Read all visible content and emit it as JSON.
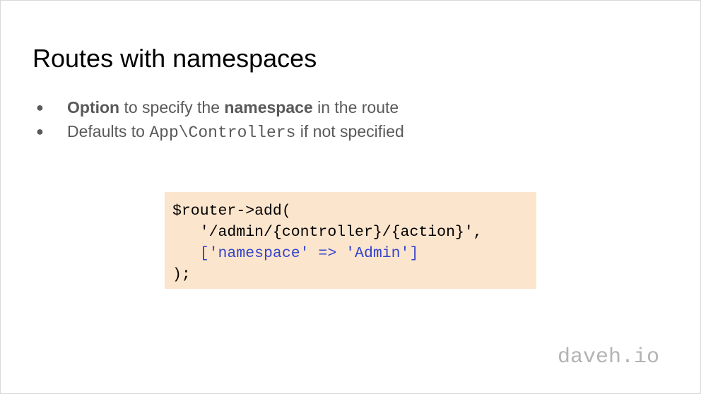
{
  "slide": {
    "title": "Routes with namespaces",
    "bullets": [
      {
        "marker": "●",
        "parts": [
          "Option",
          " to specify the ",
          "namespace",
          " in the route"
        ]
      },
      {
        "marker": "●",
        "parts": [
          "Defaults to ",
          "App\\Controllers",
          " if not specified"
        ]
      }
    ],
    "code": {
      "background_color": "#fce5cd",
      "line1": "$router->add(",
      "line2": "   '/admin/{controller}/{action}',",
      "line3": "   ['namespace' => 'Admin']",
      "line4": ");"
    },
    "watermark": "daveh.io"
  }
}
